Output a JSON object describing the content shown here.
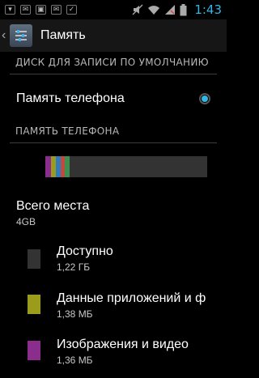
{
  "status_bar": {
    "time": "1:43",
    "icons_left": [
      "notification-icon",
      "talk-icon",
      "image-icon",
      "mail-icon",
      "tasks-icon"
    ],
    "icons_right": [
      "mute-icon",
      "wifi-icon",
      "signal-icon",
      "battery-icon"
    ]
  },
  "action_bar": {
    "title": "Память"
  },
  "default_write_section": {
    "header": "ДИСК ДЛЯ ЗАПИСИ ПО УМОЛЧАНИЮ"
  },
  "default_option": {
    "label": "Память телефона",
    "selected": true
  },
  "phone_memory_section": {
    "header": "ПАМЯТЬ ТЕЛЕФОНА"
  },
  "usage_bar": {
    "segments": [
      {
        "name": "images",
        "fraction": 0.035,
        "color": "#8a2d8c"
      },
      {
        "name": "apps",
        "fraction": 0.03,
        "color": "#9b9c1b"
      },
      {
        "name": "audio",
        "fraction": 0.03,
        "color": "#2f7bbd"
      },
      {
        "name": "downloads",
        "fraction": 0.025,
        "color": "#c04a3d"
      },
      {
        "name": "misc",
        "fraction": 0.03,
        "color": "#3d8f50"
      }
    ],
    "free_color": "#333333"
  },
  "total": {
    "title": "Всего места",
    "value": "4GB"
  },
  "items": [
    {
      "title": "Доступно",
      "value": "1,22 ГБ",
      "color": "#333333"
    },
    {
      "title": "Данные приложений и ф",
      "value": "1,38 МБ",
      "color": "#9b9c1b"
    },
    {
      "title": "Изображения и видео",
      "value": "1,36 МБ",
      "color": "#8a2d8c"
    }
  ]
}
